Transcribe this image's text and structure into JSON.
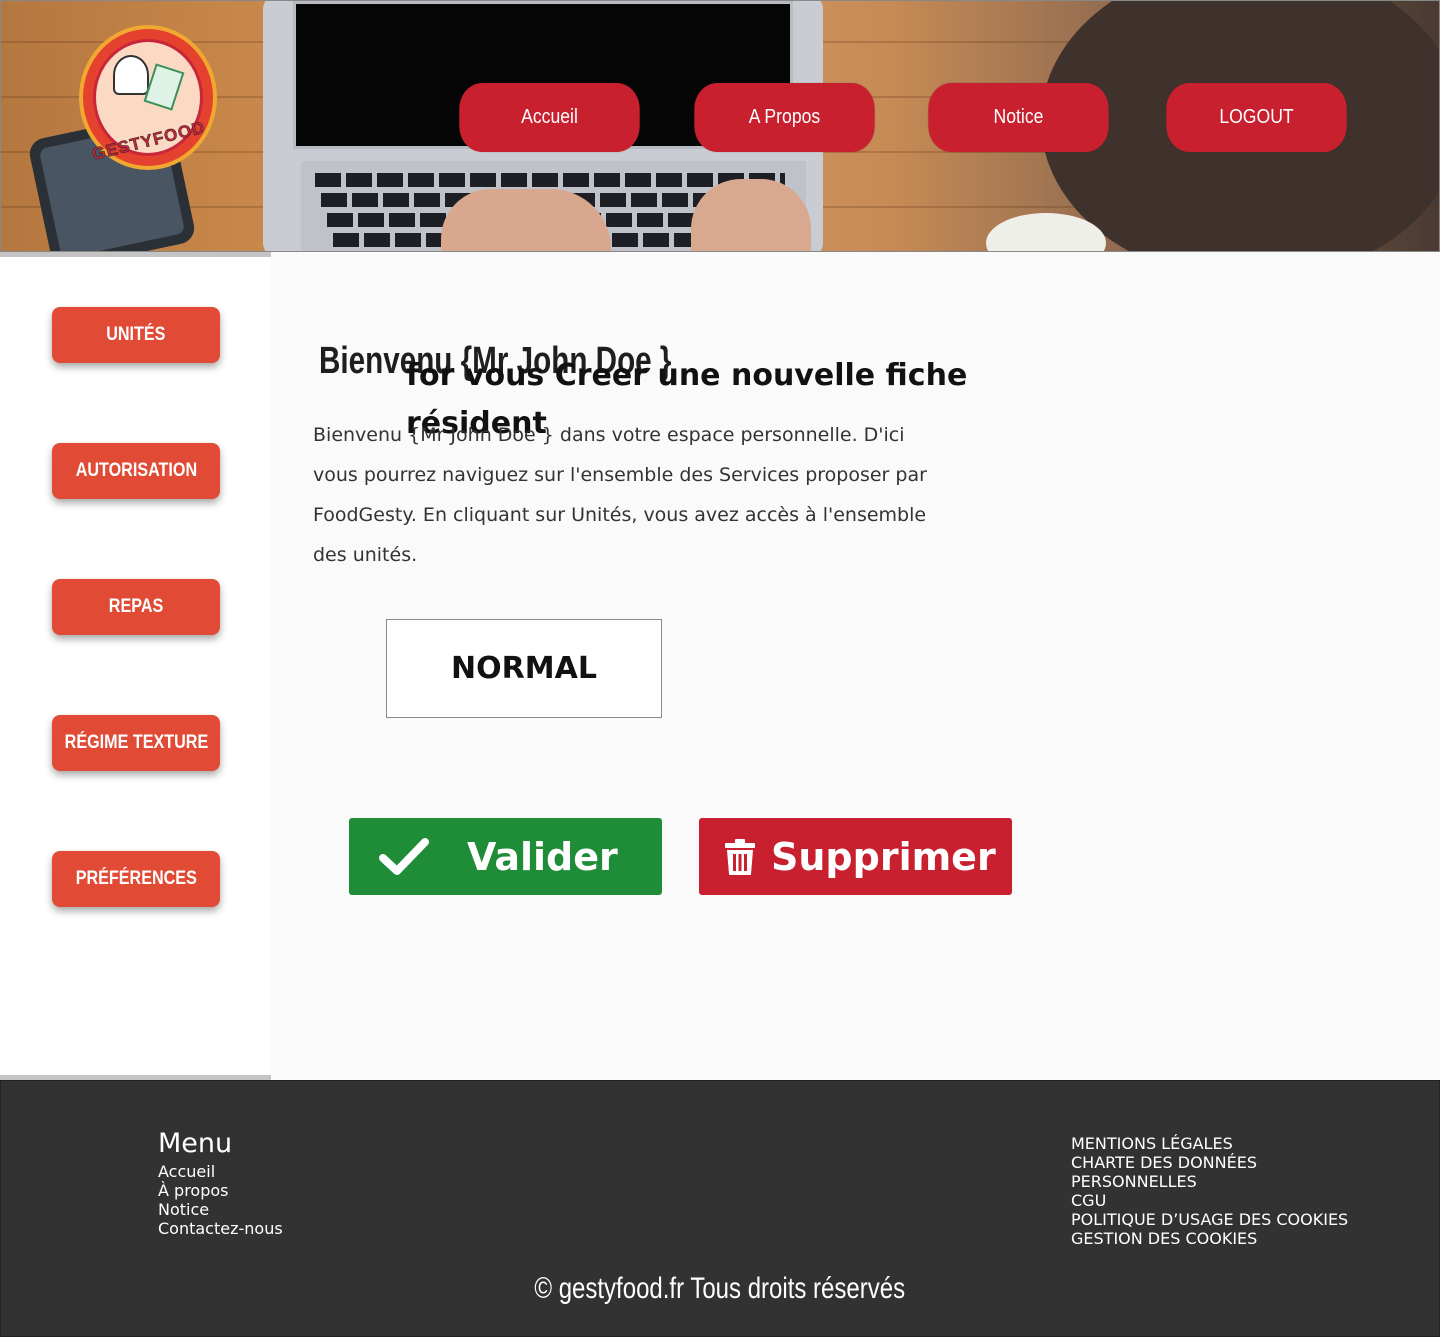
{
  "header": {
    "logo_text": "GESTYFOOD",
    "nav": [
      {
        "label": "Accueil"
      },
      {
        "label": "A Propos"
      },
      {
        "label": "Notice"
      },
      {
        "label": "LOGOUT"
      }
    ]
  },
  "sidebar": {
    "items": [
      {
        "label": "UNITÉS"
      },
      {
        "label": "AUTORISATION"
      },
      {
        "label": "REPAS"
      },
      {
        "label": "RÉGIME TEXTURE"
      },
      {
        "label": "PRÉFÉRENCES"
      }
    ]
  },
  "main": {
    "greeting": "Bienvenu  {Mr John Doe }",
    "title": "for vous  Creer une nouvelle  fiche résident",
    "intro": "Bienvenu  {Mr John Doe } dans votre espace personnelle. D'ici vous pourrez naviguez sur l'ensemble des Services proposer par FoodGesty.   En cliquant sur Unités, vous avez accès à l'ensemble des unités.",
    "choice": "NORMAL",
    "validate_label": "Valider",
    "delete_label": "Supprimer"
  },
  "footer": {
    "menu_title": "Menu",
    "menu_links": [
      "Accueil",
      "À propos",
      "Notice",
      "Contactez-nous"
    ],
    "legal_links": [
      "MENTIONS LÉGALES",
      "CHARTE DES DONNÉES",
      "PERSONNELLES",
      "CGU",
      "POLITIQUE D’USAGE DES COOKIES",
      "GESTION DES COOKIES"
    ],
    "copyright": "© gestyfood.fr  Tous droits réservés"
  },
  "colors": {
    "nav_red": "#c8202f",
    "sidebar_orange": "#e14b36",
    "validate_green": "#1f8c37",
    "footer_dark": "#323232"
  },
  "icons": [
    "check-icon",
    "trash-icon"
  ]
}
